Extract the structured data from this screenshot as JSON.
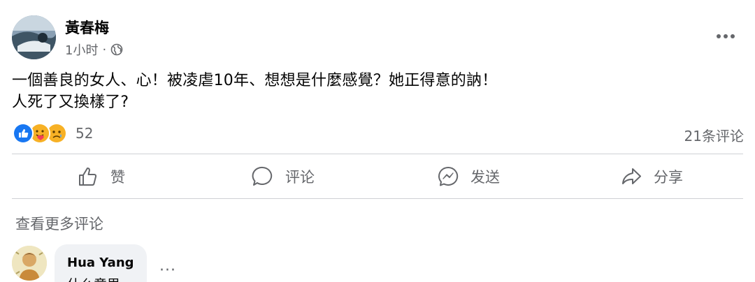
{
  "post": {
    "author": "黃春梅",
    "time": "1小时",
    "separator": "·",
    "body_line1": "一個善良的女人、心！被凌虐10年、想想是什麼感覺？她正得意的訥！",
    "body_line2": "人死了又換樣了?",
    "reaction_count": "52",
    "reactions": [
      "like-reaction",
      "care-reaction",
      "sad-reaction"
    ],
    "comment_count": "21条评论"
  },
  "actions": {
    "like": "赞",
    "comment": "评论",
    "send": "发送",
    "share": "分享"
  },
  "comments_section": {
    "view_more": "查看更多评论",
    "first_comment": {
      "author": "Hua Yang",
      "text": "什么意思",
      "more": "···"
    }
  },
  "colors": {
    "like_blue": "#1877f2",
    "reaction_yellow": "#f7b125",
    "secondary_text": "#65676b",
    "bubble_bg": "#f0f2f5"
  }
}
